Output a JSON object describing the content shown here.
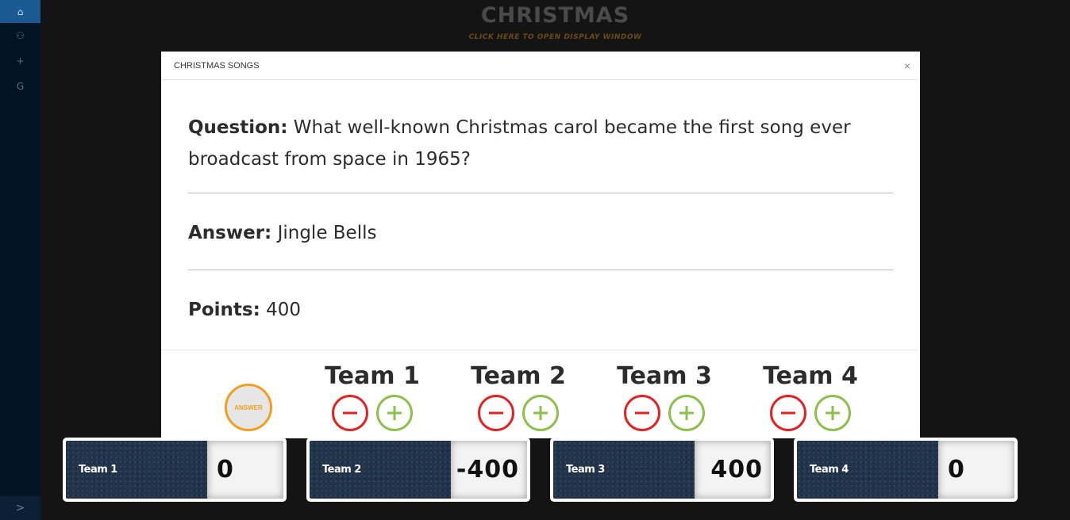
{
  "sidebar": {
    "items": [
      {
        "icon": "home-icon",
        "glyph": "⌂"
      },
      {
        "icon": "user-icon",
        "glyph": "⚇"
      },
      {
        "icon": "plus-icon",
        "glyph": "+"
      },
      {
        "icon": "google-icon",
        "glyph": "G"
      }
    ],
    "expand_glyph": ">"
  },
  "header": {
    "title": "CHRISTMAS",
    "subtitle": "CLICK HERE TO OPEN DISPLAY WINDOW"
  },
  "modal": {
    "title": "CHRISTMAS SONGS",
    "close_glyph": "×",
    "question_label": "Question:",
    "question_text": " What well-known Christmas carol became the first song ever broadcast from space in 1965?",
    "answer_label": "Answer:",
    "answer_text": " Jingle Bells",
    "points_label": "Points:",
    "points_text": " 400",
    "answer_button": "ANSWER",
    "teams": [
      {
        "name": "Team 1"
      },
      {
        "name": "Team 2"
      },
      {
        "name": "Team 3"
      },
      {
        "name": "Team 4"
      }
    ]
  },
  "scoreboard": [
    {
      "team": "Team 1",
      "score": "0"
    },
    {
      "team": "Team 2",
      "score": "-400"
    },
    {
      "team": "Team 3",
      "score": "400"
    },
    {
      "team": "Team 4",
      "score": "0"
    }
  ],
  "colors": {
    "minus": "#e22222",
    "plus": "#8cc04a",
    "answer": "#f0a020",
    "sidebar_active": "#1a5a92"
  }
}
